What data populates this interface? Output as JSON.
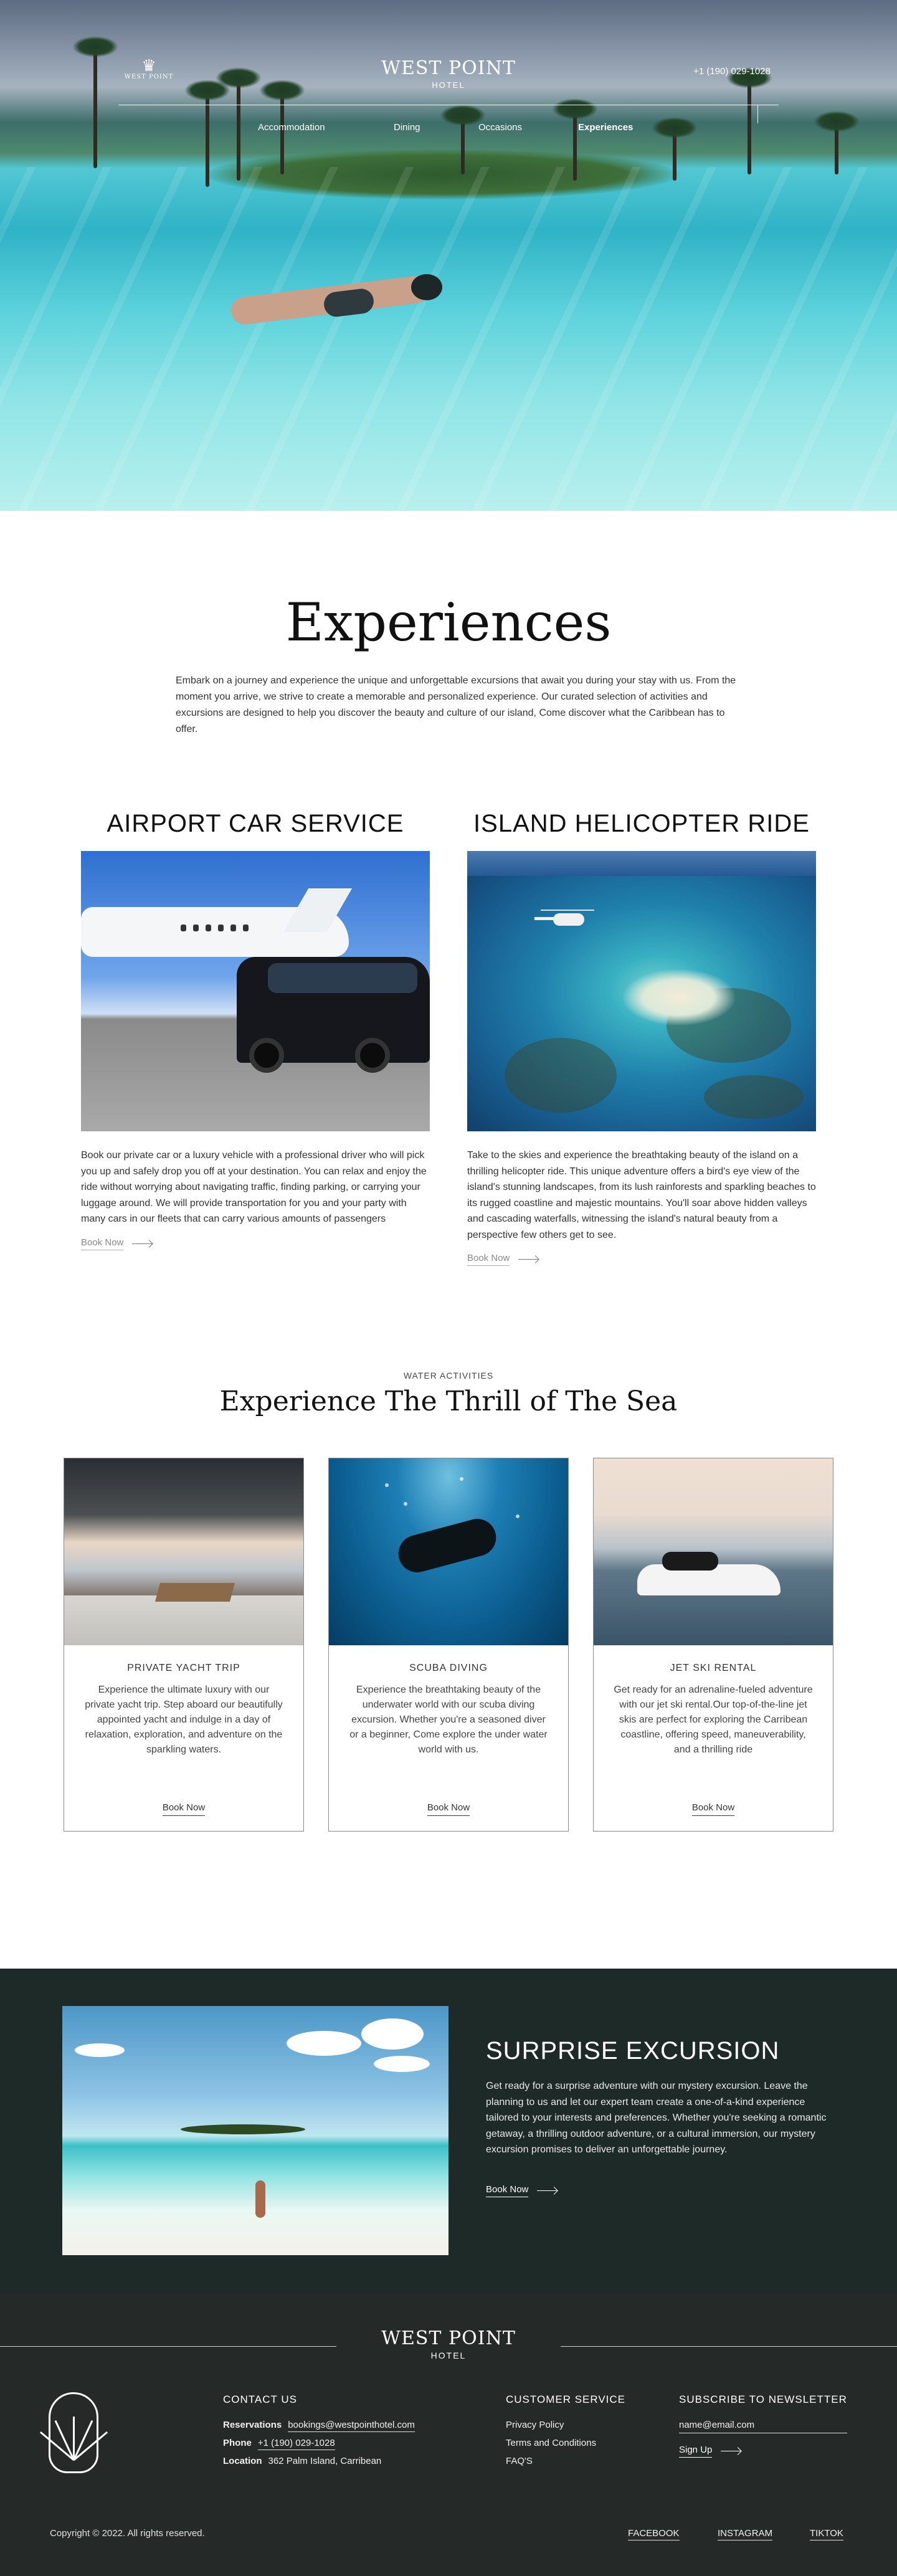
{
  "header": {
    "logo_left_text": "WEST POINT",
    "brand_name": "WEST POINT",
    "brand_sub": "HOTEL",
    "phone": "+1 (190) 029-1028",
    "menu": [
      {
        "label": "Accommodation"
      },
      {
        "label": "Dining"
      },
      {
        "label": "Occasions"
      },
      {
        "label": "Experiences",
        "active": true
      }
    ]
  },
  "intro": {
    "title": "Experiences",
    "text": "Embark on a journey and experience the unique and unforgettable excursions that await you during your stay with us. From the moment you arrive, we strive to create a memorable and personalized experience. Our curated selection of activities and excursions are designed to help you discover the beauty and culture of our island, Come discover what the Caribbean has to offer."
  },
  "services": [
    {
      "title": "AIRPORT CAR SERVICE",
      "text": "Book our private car or a luxury vehicle with a professional driver who will pick you up and safely drop you off at your destination. You can relax and enjoy the ride without worrying about navigating traffic, finding parking, or carrying your luggage around. We will provide transportation for you and your party with many cars in our fleets that can carry various amounts of passengers",
      "cta": "Book Now"
    },
    {
      "title": "ISLAND HELICOPTER RIDE",
      "text": "Take to the skies and experience the breathtaking beauty of the island on a thrilling helicopter ride. This unique adventure offers a bird's eye view of the island's stunning landscapes, from its lush rainforests and sparkling beaches to its rugged coastline and majestic mountains. You'll soar above hidden valleys and cascading waterfalls, witnessing the island's natural beauty from a perspective few others get to see.",
      "cta": "Book Now"
    }
  ],
  "water": {
    "eyebrow": "WATER ACTIVITIES",
    "title": "Experience The Thrill of The Sea",
    "cards": [
      {
        "title": "PRIVATE YACHT TRIP",
        "text": "Experience the ultimate luxury with our private yacht trip. Step aboard our beautifully appointed yacht and indulge in a day of relaxation, exploration, and adventure on the sparkling waters.",
        "cta": "Book Now"
      },
      {
        "title": "SCUBA DIVING",
        "text": "Experience the breathtaking beauty of the underwater world with our scuba diving excursion. Whether you're a seasoned diver or a beginner, Come explore the under water world with us.",
        "cta": "Book Now"
      },
      {
        "title": "JET SKI RENTAL",
        "text": "Get ready for an adrenaline-fueled adventure with our jet ski rental.Our top-of-the-line jet skis are perfect for exploring the Carribean coastline, offering speed, maneuverability, and a thrilling ride",
        "cta": "Book Now"
      }
    ]
  },
  "surprise": {
    "title": "SURPRISE EXCURSION",
    "text": "Get ready for a surprise adventure with our mystery excursion. Leave the planning to us and let our expert team create a one-of-a-kind experience tailored to your interests and preferences. Whether you're seeking a romantic getaway, a thrilling outdoor adventure, or a cultural immersion, our mystery excursion promises to deliver an unforgettable journey.",
    "cta": "Book Now"
  },
  "footer": {
    "brand_name": "WEST POINT",
    "brand_sub": "HOTEL",
    "contact": {
      "heading": "CONTACT US",
      "reservations_label": "Reservations",
      "reservations_value": "bookings@westpointhotel.com",
      "phone_label": "Phone",
      "phone_value": "+1 (190) 029-1028",
      "location_label": "Location",
      "location_value": "362 Palm Island, Carribean"
    },
    "service": {
      "heading": "CUSTOMER SERVICE",
      "links": [
        "Privacy Policy",
        "Terms and Conditions",
        "FAQ'S"
      ]
    },
    "newsletter": {
      "heading": "SUBSCRIBE TO NEWSLETTER",
      "placeholder": "name@email.com",
      "cta": "Sign Up"
    },
    "copyright": "Copyright © 2022.  All rights reserved.",
    "social": [
      "FACEBOOK",
      "INSTAGRAM",
      "TIKTOK"
    ]
  }
}
